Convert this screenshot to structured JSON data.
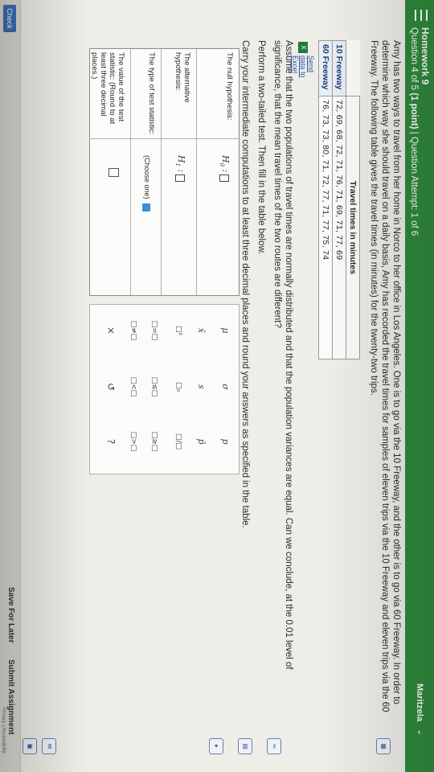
{
  "header": {
    "title": "Homework 9",
    "question_prefix": "Question 4 of 5 ",
    "points": "(1 point)",
    "attempt": " | Question Attempt: 1 of 6",
    "user": "Maritzela",
    "accent_color": "#2f8a3c"
  },
  "question": {
    "intro": "Amy has two ways to travel from her home in Norco to her office in Los Angeles. One is to go via the 10 Freeway, and the other is to go via 60 Freeway. In order to determine which way she should travel on a daily basis, Amy has recorded the travel times for samples of eleven trips via the 10 Freeway and eleven trips via the 60 Freeway. The following table gives the travel times (in minutes) for the twenty-two trips."
  },
  "data_table": {
    "header": "Travel times in minutes",
    "rows": [
      {
        "label": "10 Freeway",
        "values": "72, 69, 68, 72, 71, 76, 71, 69, 71, 77, 69"
      },
      {
        "label": "60 Freeway",
        "values": "76, 73, 73, 80, 71, 72, 77, 71, 77, 75, 74"
      }
    ],
    "send_to_excel": "Send data to Excel"
  },
  "instructions": {
    "assume": "Assume that the two populations of travel times are normally distributed and that the population variances are equal. Can we conclude, at the 0.01 level of significance, that the mean travel times of the two routes are different?",
    "perform": "Perform a two-tailed test. Then fill in the table below.",
    "carry": "Carry your intermediate computations to at least three decimal places and round your answers as specified in the table."
  },
  "hyp_table": {
    "null_label": "The null hypothesis:",
    "alt_label": "The alternative hypothesis:",
    "type_label": "The type of test statistic:",
    "value_label": "The value of the test statistic: (Round to at least three decimal places.)",
    "null_symbol": "H",
    "null_sub": "0",
    "alt_symbol": "H",
    "alt_sub": "1",
    "choose": "(Choose one)"
  },
  "palette": {
    "row1": [
      "μ",
      "σ",
      "p"
    ],
    "row2": [
      "x̄",
      "s",
      "p̂"
    ],
    "row3": [
      "□²",
      "□₀",
      "□/□"
    ],
    "row4": [
      "□=□",
      "□≤□",
      "□≥□"
    ],
    "row5": [
      "□≠□",
      "□<□",
      "□>□"
    ],
    "actions": [
      "×",
      "↺",
      "?"
    ]
  },
  "footer": {
    "check": "Check",
    "save_later": "Save For Later",
    "submit": "Submit Assignment",
    "links": "Privacy | Accessibility"
  }
}
